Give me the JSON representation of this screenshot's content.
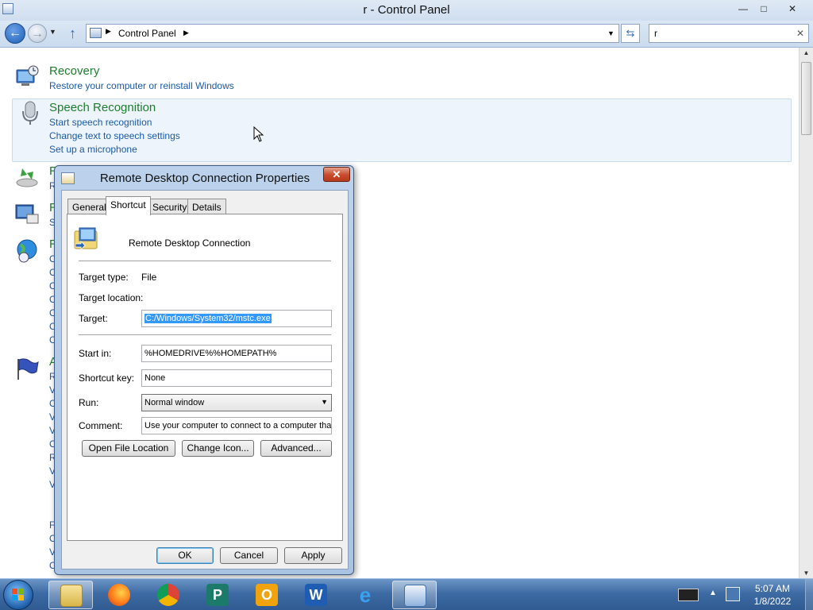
{
  "window": {
    "title": "r - Control Panel",
    "min": "—",
    "max": "□",
    "close": "✕"
  },
  "address": {
    "crumb": "Control Panel",
    "sep": "▶",
    "drop": "▼",
    "refresh": "⇆",
    "back": "←",
    "forward": "→",
    "hist": "▼",
    "up": "↑"
  },
  "search": {
    "value": "r",
    "clear": "✕"
  },
  "categories": {
    "recovery": {
      "title": "Recovery",
      "links": [
        "Restore your computer or reinstall Windows"
      ]
    },
    "speech": {
      "title": "Speech Recognition",
      "links": [
        "Start speech recognition",
        "Change text to speech settings",
        "Set up a microphone"
      ]
    }
  },
  "background_fragments": {
    "r1": "R",
    "r1b": "R",
    "r2": "R",
    "s2": "S",
    "r3": "R",
    "a4": "A",
    "col3": [
      "C",
      "C",
      "C",
      "C",
      "C",
      "C",
      "C"
    ],
    "col4": [
      "R",
      "V",
      "C",
      "V",
      "V",
      "C",
      "R",
      "V",
      "V",
      "F",
      "C",
      "V",
      "C"
    ]
  },
  "dialog": {
    "title": "Remote Desktop Connection Properties",
    "close": "✕",
    "tabs": [
      "General",
      "Shortcut",
      "Security",
      "Details"
    ],
    "active_tab": "Shortcut",
    "app_name": "Remote Desktop Connection",
    "target_type_label": "Target type:",
    "target_type": "File",
    "target_location_label": "Target location:",
    "target_label": "Target:",
    "target": "C:/Windows/System32/mstc.exe",
    "start_in_label": "Start in:",
    "start_in": "%HOMEDRIVE%%HOMEPATH%",
    "shortcut_key_label": "Shortcut key:",
    "shortcut_key": "None",
    "run_label": "Run:",
    "run": "Normal window",
    "comment_label": "Comment:",
    "comment": "Use your computer to connect to a computer that",
    "buttons": {
      "open_location": "Open File Location",
      "change_icon": "Change Icon...",
      "advanced": "Advanced..."
    },
    "footer": {
      "ok": "OK",
      "cancel": "Cancel",
      "apply": "Apply"
    }
  },
  "taskbar": {
    "items": [
      "file-explorer",
      "firefox",
      "chrome",
      "publisher",
      "outlook",
      "word",
      "internet-explorer",
      "control-panel"
    ],
    "tray_up": "▲",
    "time": "5:07 AM",
    "date": "1/8/2022"
  },
  "colors": {
    "accent": "#1e7d2e",
    "link": "#1a5aa6",
    "selection": "#3399ff"
  }
}
